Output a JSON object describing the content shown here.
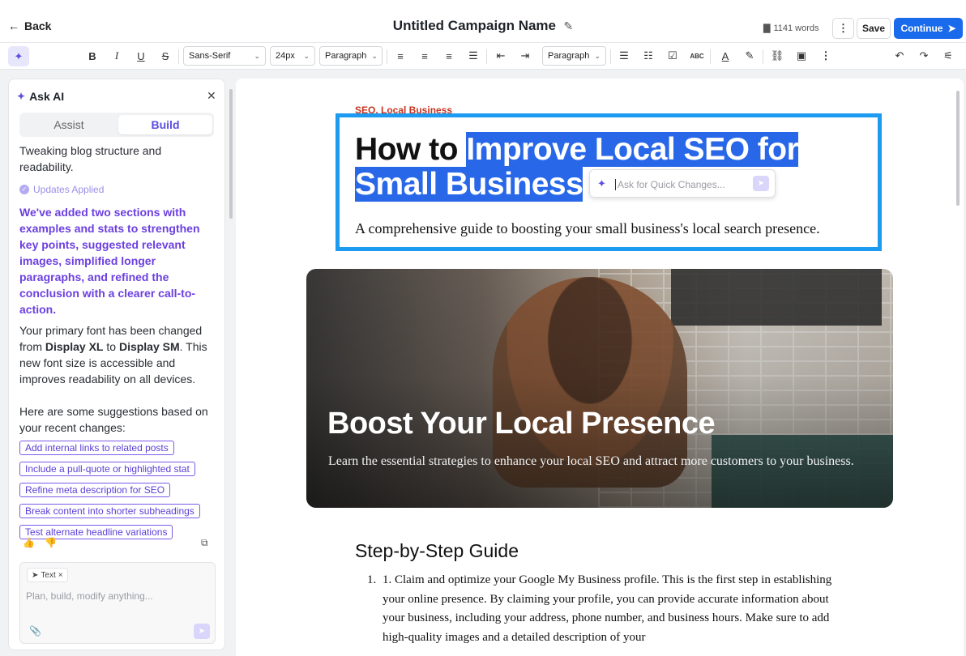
{
  "header": {
    "back_label": "Back",
    "title": "Untitled Campaign Name",
    "word_count": "1141 words",
    "save_label": "Save",
    "continue_label": "Continue"
  },
  "toolbar": {
    "font_family": "Sans-Serif",
    "font_size": "24px",
    "block_style": "Paragraph",
    "block_style_2": "Paragraph"
  },
  "ask_ai": {
    "title": "Ask AI",
    "tabs": [
      "Assist",
      "Build"
    ],
    "active_tab": "Build",
    "prev_message": "Tweaking blog structure and readability.",
    "status": "Updates Applied",
    "summary": "We've added two sections with examples and stats to strengthen key points, suggested relevant images, simplified longer paragraphs, and refined the conclusion with a clearer call-to-action.",
    "font_change": {
      "pre": "Your primary font has been changed from ",
      "from": "Display XL",
      "mid": " to ",
      "to": "Display SM",
      "post": ". This new font size is accessible and improves readability on all devices."
    },
    "suggestions_intro": "Here are some suggestions based on your recent changes:",
    "suggestions": [
      "Add internal links to related posts",
      "Include a pull-quote or highlighted stat",
      "Refine meta description for SEO",
      "Break content into shorter subheadings",
      "Test alternate headline variations"
    ],
    "input_chip": "Text",
    "input_placeholder": "Plan, build, modify anything..."
  },
  "document": {
    "eyebrow": "SEO, Local Business",
    "headline_plain": "How to ",
    "headline_selected": "Improve Local SEO for Small Business",
    "quick_placeholder": "Ask for Quick Changes...",
    "subtitle": "A comprehensive guide to boosting your small business's local search presence.",
    "hero_title": "Boost Your Local Presence",
    "hero_subtitle": "Learn the essential strategies to enhance your local SEO and attract more customers to your business.",
    "section_heading": "Step-by-Step Guide",
    "list_items": [
      {
        "num": "1.",
        "text": "1. Claim and optimize your Google My Business profile. This is the first step in establishing your online presence. By claiming your profile, you can provide accurate information about your business, including your address, phone number, and business hours. Make sure to add high-quality images and a detailed description of your"
      }
    ]
  },
  "colors": {
    "accent": "#1a6bec",
    "ai_purple": "#6b3fe0",
    "selection": "#2867e8",
    "selection_frame": "#1d9bf0",
    "eyebrow": "#c8331e"
  }
}
